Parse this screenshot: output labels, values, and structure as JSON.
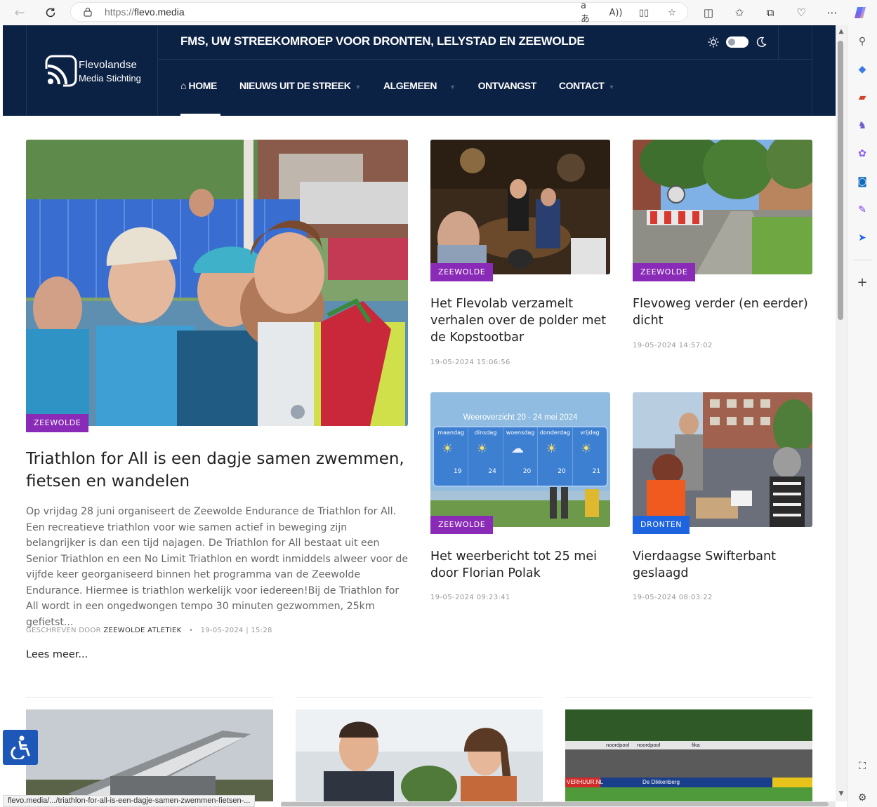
{
  "browser": {
    "url_scheme": "https://",
    "url_host": "flevo.media",
    "status_url": "flevo.media/.../triathlon-for-all-is-een-dagje-samen-zwemmen-fietsen-..."
  },
  "header": {
    "logo_line1": "Flevolandse",
    "logo_line2": "Media Stichting",
    "tagline": "FMS, UW STREEKOMROEP VOOR DRONTEN, LELYSTAD EN ZEEWOLDE",
    "nav": [
      {
        "label": "HOME",
        "icon": "home-icon",
        "active": true
      },
      {
        "label": "NIEUWS UIT DE STREEK",
        "has_dropdown": true
      },
      {
        "label": "ALGEMEEN",
        "has_dropdown": true
      },
      {
        "label": "ONTVANGST",
        "has_dropdown": false
      },
      {
        "label": "CONTACT",
        "has_dropdown": true
      }
    ]
  },
  "featured": {
    "tag": "ZEEWOLDE",
    "title": "Triathlon for All is een dagje samen zwemmen, fietsen en wandelen",
    "excerpt": "Op vrijdag 28 juni organiseert de Zeewolde Endurance de Triathlon for All. Een recreatieve triathlon voor wie samen actief in beweging zijn belangrijker is dan een tijd najagen. De Triathlon for All bestaat uit een Senior Triathlon en een No Limit Triathlon en wordt inmiddels alweer voor de vijfde keer georganiseerd binnen het programma van de Zeewolde Endurance. Hiermee is triathlon werkelijk voor iedereen!Bij de Triathlon for All wordt in een ongedwongen tempo 30 minuten gezwommen, 25km gefietst...",
    "meta_prefix": "GESCHREVEN DOOR",
    "author": "ZEEWOLDE ATLETIEK",
    "date": "19-05-2024 | 15:28",
    "read_more": "Lees meer..."
  },
  "cards": [
    {
      "tag": "ZEEWOLDE",
      "title": "Het Flevolab verzamelt verhalen over de polder met de Kopstootbar",
      "date": "19-05-2024 15:06:56"
    },
    {
      "tag": "ZEEWOLDE",
      "title": "Flevoweg verder (en eerder) dicht",
      "date": "19-05-2024 14:57:02"
    },
    {
      "tag": "ZEEWOLDE",
      "title": "Het weerbericht tot 25 mei door Florian Polak",
      "date": "19-05-2024 09:23:41"
    },
    {
      "tag": "DRONTEN",
      "title": "Vierdaagse Swifterbant geslaagd",
      "date": "19-05-2024 08:03:22"
    }
  ],
  "weather_graphic": {
    "title": "Weeroverzicht 20 - 24 mei 2024",
    "days": [
      "maandag",
      "dinsdag",
      "woensdag",
      "donderdag",
      "vrijdag"
    ],
    "temps": [
      "19",
      "24",
      "20",
      "20",
      "21"
    ]
  },
  "stadium_banners": [
    "noordpool",
    "noordpool",
    "fika",
    "VERHUUR.NL",
    "De Dikkenberg"
  ],
  "colors": {
    "header_bg": "#0c2244",
    "tag_purple": "#8a2bb8",
    "tag_blue": "#1e63e0"
  }
}
